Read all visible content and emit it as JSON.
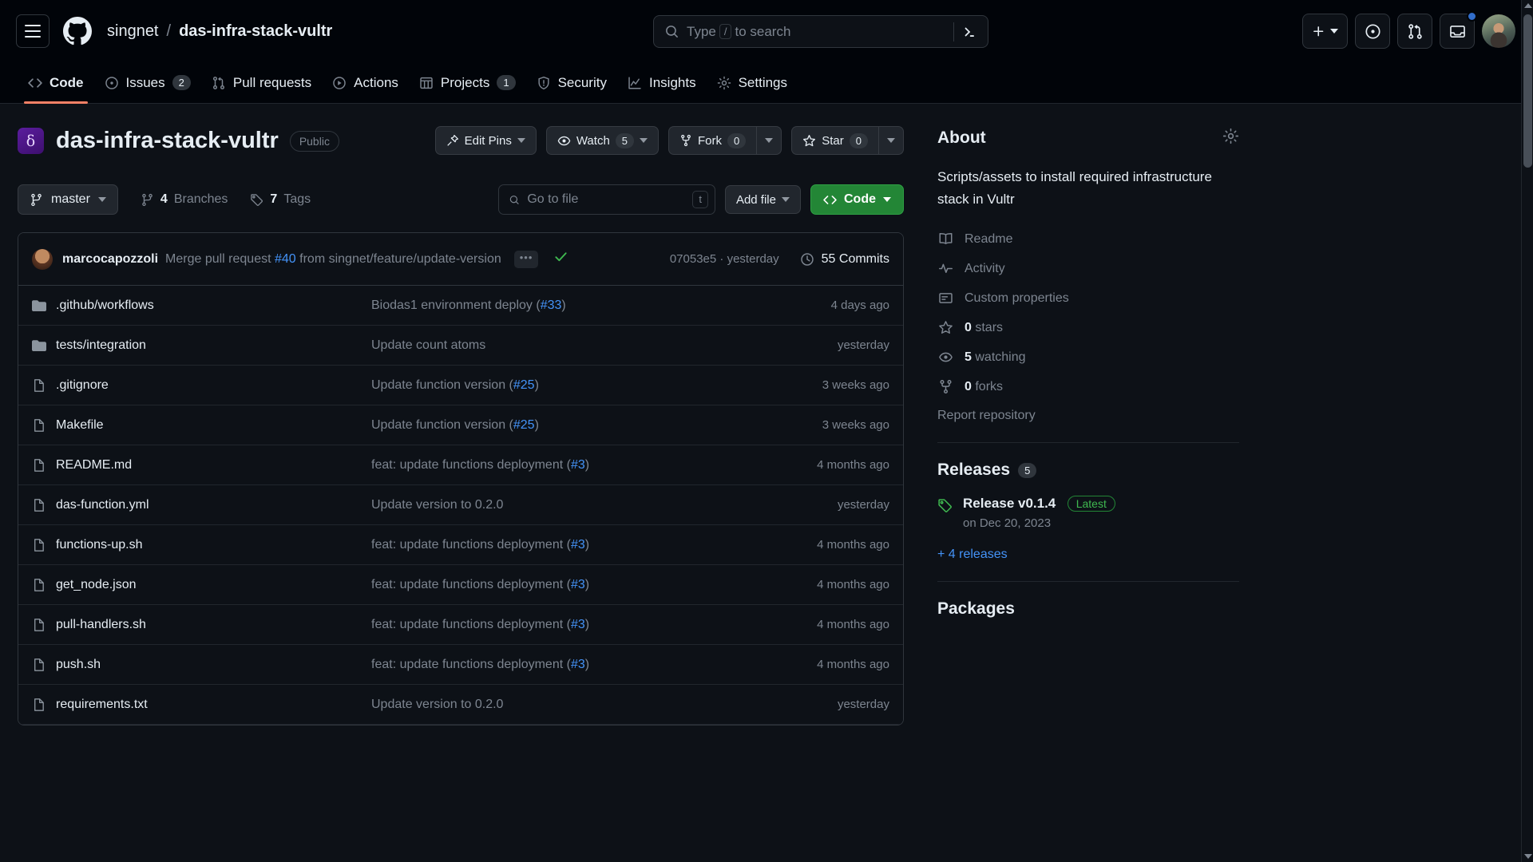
{
  "header": {
    "breadcrumb": {
      "owner": "singnet",
      "separator": "/",
      "repo": "das-infra-stack-vultr"
    },
    "search": {
      "placeholder_prefix": "Type",
      "slash_key": "/",
      "placeholder_suffix": "to search"
    },
    "icons": {
      "hamburger": "hamburger-icon",
      "logo": "github-logo-icon",
      "search": "search-icon",
      "command_palette": "command-palette-icon",
      "plus": "plus-icon",
      "issues_dot": "issue-opened-icon",
      "pull_requests": "git-pull-request-icon",
      "inbox": "inbox-icon",
      "avatar": "user-avatar"
    }
  },
  "repo_nav": {
    "tabs": [
      {
        "label": "Code",
        "icon": "code-icon",
        "count": null,
        "active": true
      },
      {
        "label": "Issues",
        "icon": "issue-opened-icon",
        "count": "2",
        "active": false
      },
      {
        "label": "Pull requests",
        "icon": "git-pull-request-icon",
        "count": null,
        "active": false
      },
      {
        "label": "Actions",
        "icon": "play-icon",
        "count": null,
        "active": false
      },
      {
        "label": "Projects",
        "icon": "table-icon",
        "count": "1",
        "active": false
      },
      {
        "label": "Security",
        "icon": "shield-icon",
        "count": null,
        "active": false
      },
      {
        "label": "Insights",
        "icon": "graph-icon",
        "count": null,
        "active": false
      },
      {
        "label": "Settings",
        "icon": "gear-icon",
        "count": null,
        "active": false
      }
    ]
  },
  "repo_header": {
    "avatar_glyph": "δ",
    "name": "das-infra-stack-vultr",
    "visibility": "Public",
    "actions": {
      "edit_pins": "Edit Pins",
      "watch": "Watch",
      "watch_count": "5",
      "fork": "Fork",
      "fork_count": "0",
      "star": "Star",
      "star_count": "0"
    }
  },
  "toolbar": {
    "branch": "master",
    "branches_count": "4",
    "branches_label": "Branches",
    "tags_count": "7",
    "tags_label": "Tags",
    "go_to_file_placeholder": "Go to file",
    "go_to_file_value": "",
    "go_to_file_key": "t",
    "add_file": "Add file",
    "code_button": "Code"
  },
  "commit_bar": {
    "author": "marcocapozzoli",
    "message_prefix": "Merge pull request ",
    "message_link": "#40",
    "message_suffix": " from singnet/feature/update-version",
    "ellipsis": "•••",
    "status_icon": "check-icon",
    "hash": "07053e5",
    "hash_separator": "·",
    "hash_time": "yesterday",
    "commits_count": "55 Commits",
    "history_icon": "history-icon"
  },
  "files": [
    {
      "icon": "folder-icon",
      "name": ".github/workflows",
      "msg_prefix": "Biodas1 environment deploy (",
      "msg_link": "#33",
      "msg_suffix": ")",
      "time": "4 days ago"
    },
    {
      "icon": "folder-icon",
      "name": "tests/integration",
      "msg_prefix": "Update count atoms",
      "msg_link": "",
      "msg_suffix": "",
      "time": "yesterday"
    },
    {
      "icon": "file-icon",
      "name": ".gitignore",
      "msg_prefix": "Update function version (",
      "msg_link": "#25",
      "msg_suffix": ")",
      "time": "3 weeks ago"
    },
    {
      "icon": "file-icon",
      "name": "Makefile",
      "msg_prefix": "Update function version (",
      "msg_link": "#25",
      "msg_suffix": ")",
      "time": "3 weeks ago"
    },
    {
      "icon": "file-icon",
      "name": "README.md",
      "msg_prefix": "feat: update functions deployment (",
      "msg_link": "#3",
      "msg_suffix": ")",
      "time": "4 months ago"
    },
    {
      "icon": "file-icon",
      "name": "das-function.yml",
      "msg_prefix": "Update version to 0.2.0",
      "msg_link": "",
      "msg_suffix": "",
      "time": "yesterday"
    },
    {
      "icon": "file-icon",
      "name": "functions-up.sh",
      "msg_prefix": "feat: update functions deployment (",
      "msg_link": "#3",
      "msg_suffix": ")",
      "time": "4 months ago"
    },
    {
      "icon": "file-icon",
      "name": "get_node.json",
      "msg_prefix": "feat: update functions deployment (",
      "msg_link": "#3",
      "msg_suffix": ")",
      "time": "4 months ago"
    },
    {
      "icon": "file-icon",
      "name": "pull-handlers.sh",
      "msg_prefix": "feat: update functions deployment (",
      "msg_link": "#3",
      "msg_suffix": ")",
      "time": "4 months ago"
    },
    {
      "icon": "file-icon",
      "name": "push.sh",
      "msg_prefix": "feat: update functions deployment (",
      "msg_link": "#3",
      "msg_suffix": ")",
      "time": "4 months ago"
    },
    {
      "icon": "file-icon",
      "name": "requirements.txt",
      "msg_prefix": "Update version to 0.2.0",
      "msg_link": "",
      "msg_suffix": "",
      "time": "yesterday"
    }
  ],
  "about": {
    "title": "About",
    "settings_icon": "gear-icon",
    "description": "Scripts/assets to install required infrastructure stack in Vultr",
    "links": [
      {
        "icon": "book-icon",
        "label": "Readme",
        "bold": ""
      },
      {
        "icon": "pulse-icon",
        "label": "Activity",
        "bold": ""
      },
      {
        "icon": "properties-icon",
        "label": "Custom properties",
        "bold": ""
      },
      {
        "icon": "star-icon",
        "label": "stars",
        "bold": "0"
      },
      {
        "icon": "eye-icon",
        "label": "watching",
        "bold": "5"
      },
      {
        "icon": "fork-icon",
        "label": "forks",
        "bold": "0"
      }
    ],
    "report": "Report repository"
  },
  "releases": {
    "title": "Releases",
    "count": "5",
    "latest": {
      "name": "Release v0.1.4",
      "badge": "Latest",
      "date": "on Dec 20, 2023",
      "icon": "tag-icon"
    },
    "more": "+ 4 releases"
  },
  "packages": {
    "title": "Packages"
  },
  "colors": {
    "page_bg": "#0d1117",
    "header_bg": "#010409",
    "border": "#30363d",
    "accent_link": "#4493f8",
    "green": "#238636",
    "active_tab": "#f78166",
    "muted_text": "#7d8590"
  }
}
